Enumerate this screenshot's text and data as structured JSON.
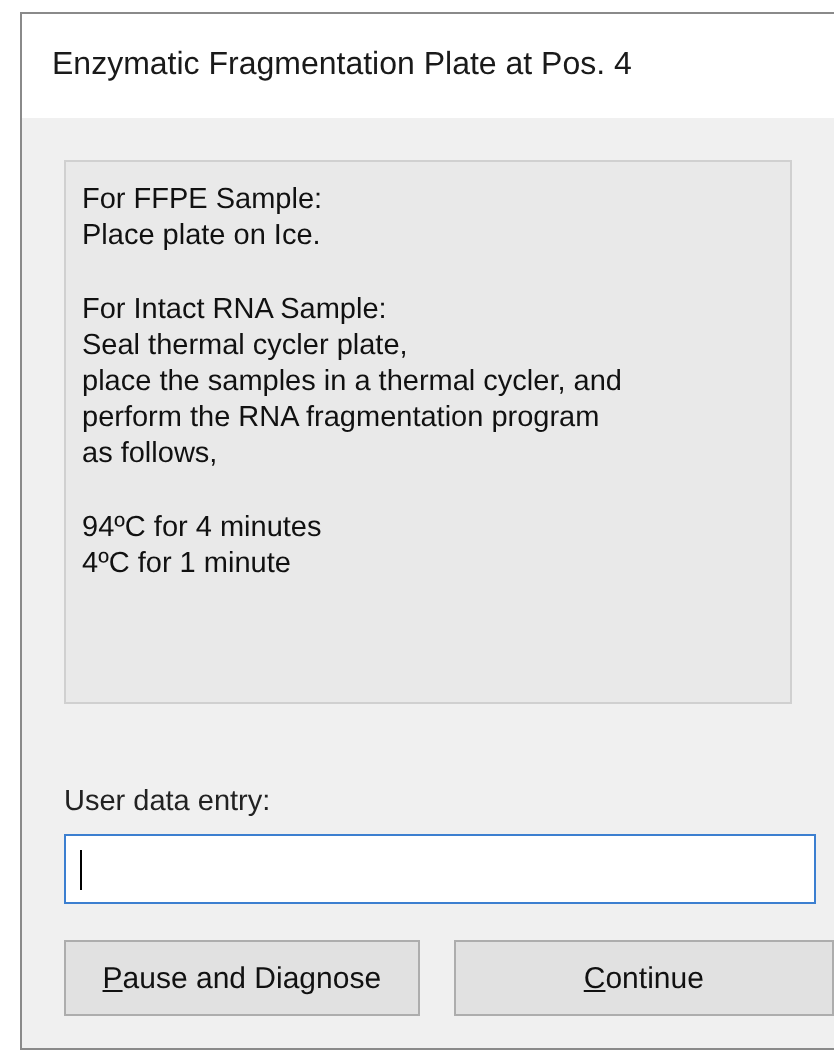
{
  "window": {
    "title": "Enzymatic Fragmentation Plate at Pos. 4"
  },
  "message": {
    "paragraphs": [
      "For FFPE Sample:\nPlace plate on Ice.",
      "For Intact RNA Sample:\nSeal thermal cycler plate,\nplace the samples in a thermal cycler, and\nperform the RNA fragmentation program\nas follows,",
      "94ºC for 4 minutes\n4ºC for 1 minute"
    ]
  },
  "entry": {
    "label": "User data entry:",
    "focused": true
  },
  "buttons": [
    {
      "mnemonic": "P",
      "rest": "ause and Diagnose"
    },
    {
      "mnemonic": "C",
      "rest": "ontinue"
    }
  ]
}
